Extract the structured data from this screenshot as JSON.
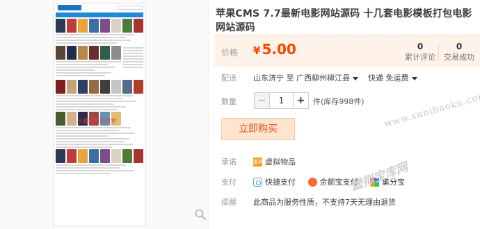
{
  "product": {
    "title": "苹果CMS 7.7最新电影网站源码 十几套电影模板打包电影网站源码"
  },
  "thumbnail": {
    "watermark_text": "小蓝网络工作室",
    "poster_colors_1": [
      "#2b3a55",
      "#c23b3b",
      "#e8a33a",
      "#3a6ea5",
      "#7a4e8c",
      "#d9d2c4",
      "#4f7a3a",
      "#a83232"
    ],
    "poster_colors_2": [
      "#5b4636",
      "#1f2f4a",
      "#b8864b",
      "#6b2d2d",
      "#2e5d4b",
      "#8c8c8c"
    ],
    "poster_colors_3": [
      "#7d1f1f",
      "#c9a27a",
      "#2d3e66",
      "#9a6b3f",
      "#3f3f3f",
      "#c4c4c4",
      "#566c8a",
      "#b03c2e"
    ],
    "poster_colors_4": [
      "#4a5b2f",
      "#d1b38a",
      "#2a2a4a",
      "#a04848",
      "#6a8fb5",
      "#e0c070"
    ]
  },
  "price": {
    "label": "价格",
    "currency": "¥",
    "value": "5.00",
    "color": "#ff4400"
  },
  "stats": {
    "reviews": {
      "count": "0",
      "label": "累计评论"
    },
    "sales": {
      "count": "0",
      "label": "交易成功"
    }
  },
  "shipping": {
    "label": "配送",
    "from": "山东济宁",
    "to_word": "至",
    "destination": "广西柳州柳江县",
    "method": "快递 免运费"
  },
  "quantity": {
    "label": "数量",
    "value": "1",
    "minus": "−",
    "plus": "+",
    "stock_text": "件(库存998件)"
  },
  "buy_button": {
    "label": "立即购买"
  },
  "promise": {
    "label": "承诺",
    "badge_text": "虚拟",
    "text": "虚拟物品"
  },
  "payment": {
    "label": "支付",
    "methods": [
      "快捷支付",
      "余额宝支付",
      "集分宝"
    ]
  },
  "notice": {
    "label": "提醒",
    "text": "此商品为服务性质，不支持7天无理由退货"
  },
  "watermarks": {
    "domain": "www.xunibaoku.com",
    "brand": "虚拟宝库网"
  }
}
